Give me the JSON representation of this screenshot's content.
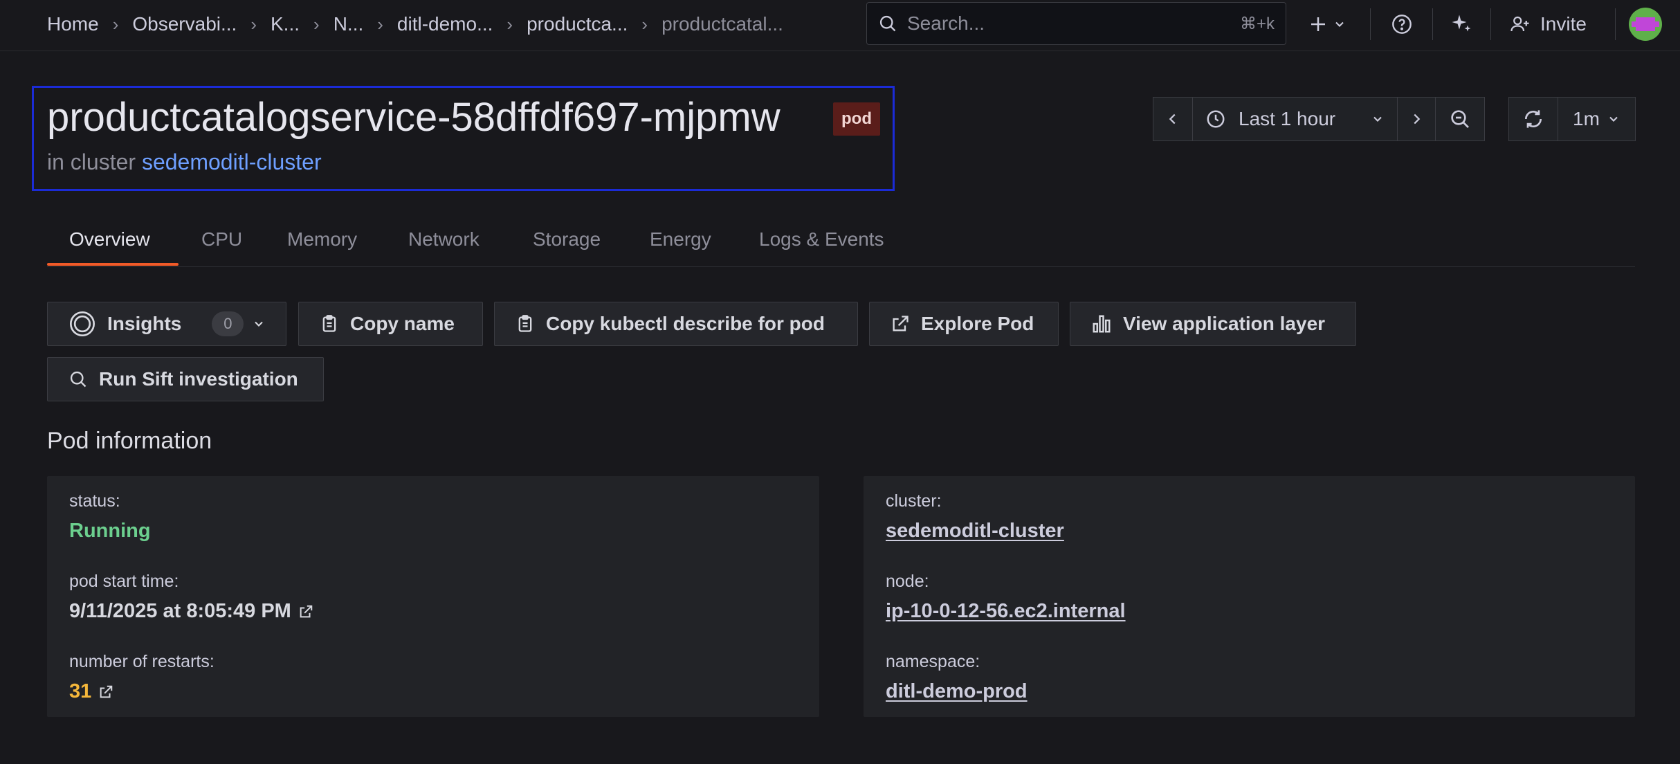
{
  "breadcrumbs": [
    "Home",
    "Observabi...",
    "K...",
    "N...",
    "ditl-demo...",
    "productca...",
    "productcatal..."
  ],
  "search": {
    "placeholder": "Search...",
    "shortcut": "⌘+k"
  },
  "topbar": {
    "invite_label": "Invite"
  },
  "header": {
    "title": "productcatalogservice-58dffdf697-mjpmw",
    "badge": "pod",
    "subtitle_prefix": "in cluster",
    "cluster_link": "sedemoditl-cluster"
  },
  "time_controls": {
    "range_label": "Last 1 hour",
    "refresh_interval": "1m"
  },
  "tabs": [
    "Overview",
    "CPU",
    "Memory",
    "Network",
    "Storage",
    "Energy",
    "Logs & Events"
  ],
  "actions": {
    "insights_label": "Insights",
    "insights_count": "0",
    "copy_name": "Copy name",
    "copy_kubectl": "Copy kubectl describe for pod",
    "explore_pod": "Explore Pod",
    "view_app_layer": "View application layer",
    "run_sift": "Run Sift investigation"
  },
  "pod_info": {
    "section_title": "Pod information",
    "left": [
      {
        "label": "status:",
        "value": "Running"
      },
      {
        "label": "pod start time:",
        "value": "9/11/2025 at 8:05:49 PM"
      },
      {
        "label": "number of restarts:",
        "value": "31"
      }
    ],
    "right": [
      {
        "label": "cluster:",
        "value": "sedemoditl-cluster"
      },
      {
        "label": "node:",
        "value": "ip-10-0-12-56.ec2.internal"
      },
      {
        "label": "namespace:",
        "value": "ditl-demo-prod"
      }
    ]
  },
  "colors": {
    "accent_tab": "#f05a28",
    "status_running": "#6ccf8e",
    "restarts": "#f5b73b",
    "link": "#6e9fff",
    "highlight_box": "#1b2bd6"
  }
}
